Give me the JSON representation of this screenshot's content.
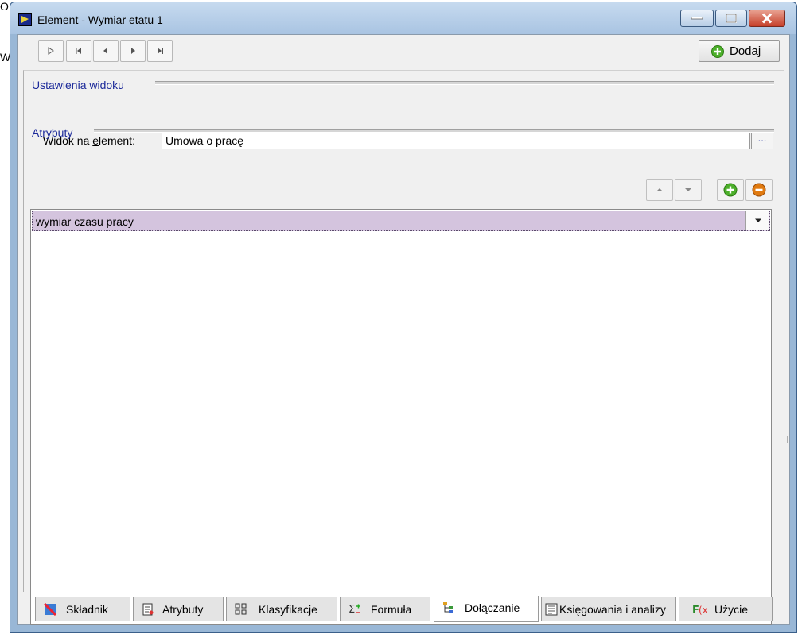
{
  "window": {
    "title": "Element - Wymiar etatu 1"
  },
  "toolbar": {
    "add_label": "Dodaj"
  },
  "view_settings": {
    "title": "Ustawienia widoku",
    "field_label_pre": "Widok na ",
    "field_label_u": "e",
    "field_label_post": "lement:",
    "field_value": "Umowa o pracę",
    "browse_label": "..."
  },
  "attributes": {
    "title": "Atrybuty",
    "items": [
      {
        "label": "wymiar czasu pracy"
      }
    ]
  },
  "tabs": [
    {
      "label": "Składnik",
      "icon": "component-icon"
    },
    {
      "label": "Atrybuty",
      "icon": "attributes-icon"
    },
    {
      "label": "Klasyfikacje",
      "icon": "classification-icon"
    },
    {
      "label": "Formuła",
      "icon": "formula-icon"
    },
    {
      "label": "Dołączanie",
      "icon": "attach-icon",
      "active": true
    },
    {
      "label": "Księgowania i analizy",
      "icon": "accounting-icon"
    },
    {
      "label": "Użycie",
      "icon": "function-icon"
    }
  ],
  "background": {
    "char1": "O",
    "char2": "W"
  },
  "colors": {
    "selected_row": "#d4c4de",
    "section_title": "#1c2a9a",
    "add_green": "#4caf2a",
    "remove_orange": "#e07a10"
  }
}
